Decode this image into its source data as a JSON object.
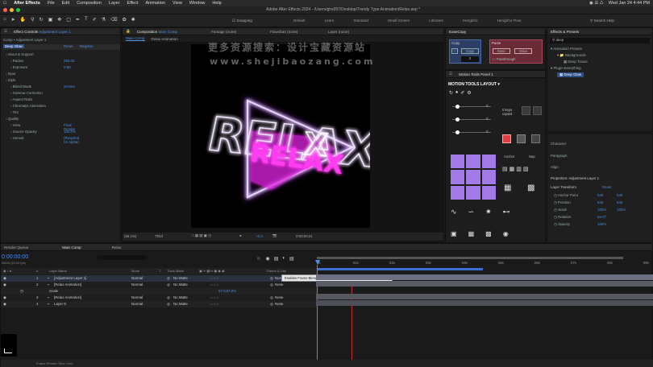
{
  "menubar": {
    "app": "After Effects",
    "items": [
      "File",
      "Edit",
      "Composition",
      "Layer",
      "Effect",
      "Animation",
      "View",
      "Window",
      "Help"
    ],
    "date": "Wed Jan 24 4:44 PM"
  },
  "window": {
    "title": "Adobe After Effects 2024 - /Users/ghs097/Desktop/Trendy Type Animation/Relax.aep *"
  },
  "workspace": {
    "snapping": "Snapping",
    "items": [
      "Default",
      "Learn",
      "Standard",
      "Small Screen",
      "Libraries",
      "Hengbho",
      "Hengbho Flow"
    ],
    "search": "Search Help"
  },
  "effect_controls": {
    "tab": "Effect Controls",
    "tab_layer": "Adjustment Layer 1",
    "breadcrumb": "Comp • Adjustment Layer 1",
    "effect_name": "Deep Glow",
    "reset": "Reset",
    "register": "Register",
    "rows": [
      {
        "label": "About & Support",
        "value": ""
      },
      {
        "label": "Radius",
        "value": "250.00"
      },
      {
        "label": "Exposure",
        "value": "0.80"
      },
      {
        "label": "Input",
        "value": ""
      },
      {
        "label": "Style",
        "value": ""
      },
      {
        "label": "Blend Mode",
        "value": "Screen"
      },
      {
        "label": "Gamma Correction",
        "value": ""
      },
      {
        "label": "Aspect Ratio",
        "value": ""
      },
      {
        "label": "Chromatic Aberration",
        "value": ""
      },
      {
        "label": "Tint",
        "value": ""
      },
      {
        "label": "Quality",
        "value": ""
      },
      {
        "label": "View",
        "value": "Final Render"
      },
      {
        "label": "Source Opacity",
        "value": "100.0%"
      },
      {
        "label": "Unmult",
        "value": "(Required for Alpha)"
      }
    ]
  },
  "composition": {
    "tab": "Composition",
    "tab_name": "Main Comp",
    "subtabs": [
      "Main Comp",
      "Relax Animation"
    ],
    "footage": "Footage (none)",
    "flowchart": "Flowchart (none)",
    "layer": "Layer (none)",
    "canvas_text": "RELAX",
    "zoom": "(66.1%)",
    "quality": "Third",
    "exposure": "+0.0",
    "time": "0:00:00:21"
  },
  "watermark": {
    "line1": "更多资源搜索：设计宝藏资源站",
    "line2": "www.shejibaozang.com"
  },
  "easecopy": {
    "tab": "EaseCopy",
    "copy": "Copy",
    "paste": "Paste",
    "copy_btn": "Copy",
    "ease_btn": "Ease",
    "value_btn": "Value",
    "passthrough": "Passthrough",
    "num": "0"
  },
  "motion_tools": {
    "tab": "Motion Tools Panel 1",
    "layout": "MOTION TOOLS LAYOUT",
    "keys_copied": "0 keys copied",
    "val1": "0",
    "val2": "0",
    "val3": "0",
    "anchor": "Anchor",
    "nap": "Nap"
  },
  "effects_presets": {
    "tab": "Effects & Presets",
    "search": "deep",
    "items": [
      "Animation Presets",
      "Backgrounds",
      "Deep Tissue",
      "Plugin Everything",
      "Deep Glow"
    ]
  },
  "properties": {
    "character": "Character",
    "paragraph": "Paragraph",
    "align": "Align",
    "title": "Properties: Adjustment Layer 1",
    "layer_transform": "Layer Transform",
    "reset": "Reset",
    "rows": [
      {
        "label": "Anchor Point",
        "v1": "540",
        "v2": "540"
      },
      {
        "label": "Position",
        "v1": "540",
        "v2": "540"
      },
      {
        "label": "Scale",
        "v1": "100%",
        "v2": "100%"
      },
      {
        "label": "Rotation",
        "v1": "0x+0°",
        "v2": ""
      },
      {
        "label": "Opacity",
        "v1": "100%",
        "v2": ""
      }
    ]
  },
  "timeline": {
    "tabs": [
      "Render Queue",
      "Main Comp",
      "Relax"
    ],
    "timecode": "0:00:00:00",
    "fps": "00000 (24.00 fps)",
    "col_layer_name": "Layer Name",
    "col_mode": "Mode",
    "col_t": "T",
    "col_trkmat": "Track Matte",
    "col_parent": "Parent & Link",
    "ruler": [
      "0s",
      "01s",
      "02s",
      "03s",
      "04s",
      "05s",
      "06s",
      "07s",
      "08s",
      "09s"
    ],
    "tooltip": "Enables Frame Blending for all layers with the Frame Blend switch set",
    "layers": [
      {
        "num": "1",
        "name": "[Adjustment Layer 1]",
        "mode": "Normal",
        "matte": "No Matte",
        "parent": "None"
      },
      {
        "num": "2",
        "name": "[Relax Animation]",
        "mode": "Normal",
        "matte": "No Matte",
        "parent": "None"
      },
      {
        "num": "",
        "name": "Scale",
        "mode": "",
        "matte": "",
        "parent": "57.0,57.0%"
      },
      {
        "num": "3",
        "name": "[Relax Animation]",
        "mode": "Normal",
        "matte": "No Matte",
        "parent": "None"
      },
      {
        "num": "4",
        "name": "Layer 8",
        "mode": "Normal",
        "matte": "No Matte",
        "parent": "None"
      }
    ],
    "footer": "Frame Render Time: 1ms"
  }
}
